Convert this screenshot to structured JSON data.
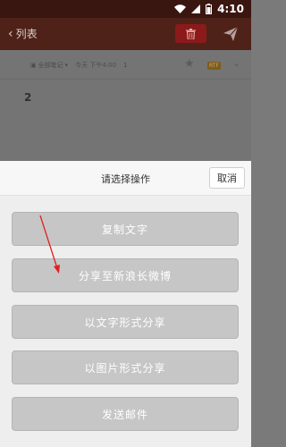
{
  "status": {
    "time": "4:10"
  },
  "header": {
    "back_label": "列表"
  },
  "note": {
    "folder": "全部笔记",
    "time": "今天 下午4:00",
    "count": "1",
    "format_badge": "RTF",
    "content": "2"
  },
  "sheet": {
    "title": "请选择操作",
    "cancel_label": "取消",
    "actions": [
      {
        "label": "复制文字"
      },
      {
        "label": "分享至新浪长微博"
      },
      {
        "label": "以文字形式分享"
      },
      {
        "label": "以图片形式分享"
      },
      {
        "label": "发送邮件"
      }
    ]
  },
  "annotation": {
    "arrow_color": "#e02020"
  },
  "icons": [
    "wifi-icon",
    "signal-icon",
    "battery-icon",
    "chevron-left-icon",
    "trash-icon",
    "send-icon",
    "star-icon",
    "chevron-down-icon"
  ]
}
